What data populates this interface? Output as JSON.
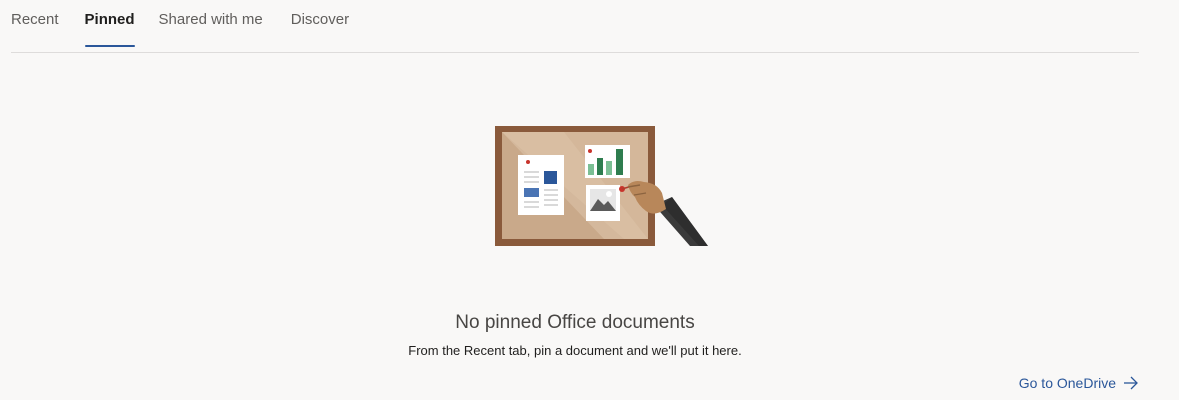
{
  "tabs": [
    {
      "label": "Recent",
      "selected": false
    },
    {
      "label": "Pinned",
      "selected": true
    },
    {
      "label": "Shared with me",
      "selected": false
    },
    {
      "label": "Discover",
      "selected": false
    }
  ],
  "empty_state": {
    "illustration_icon": "corkboard-pin-illustration",
    "title": "No pinned Office documents",
    "subtitle": "From the Recent tab, pin a document and we'll put it here."
  },
  "link": {
    "label": "Go to OneDrive",
    "icon": "arrow-right-icon"
  },
  "colors": {
    "accent": "#2b579a",
    "background": "#f9f8f7",
    "frame": "#8a5a3b",
    "chart_green": "#2e7d4f"
  }
}
